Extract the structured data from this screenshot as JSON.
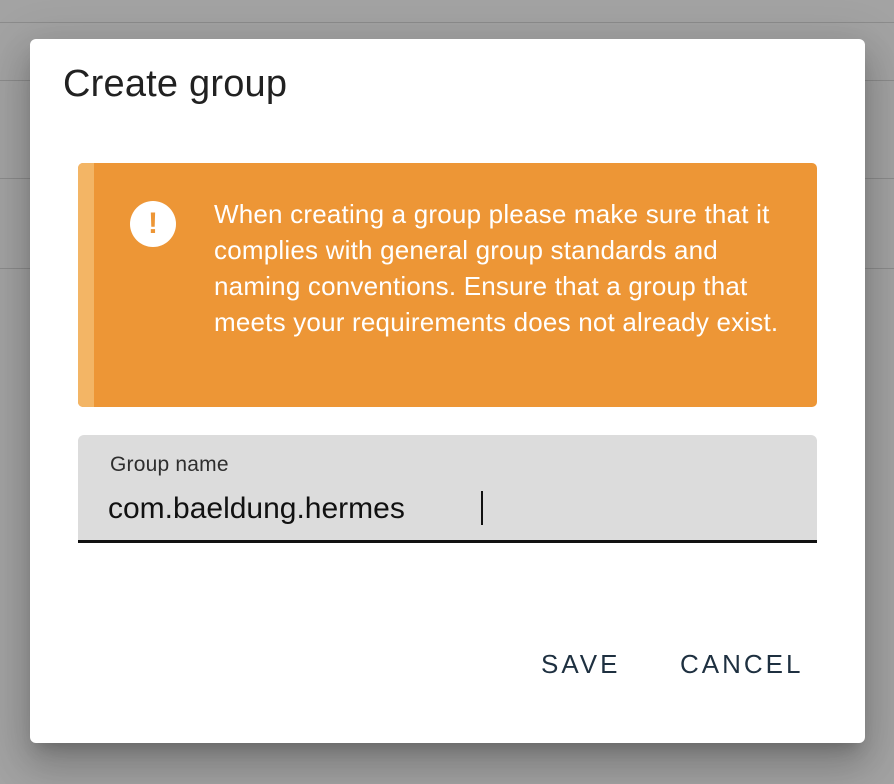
{
  "dialog": {
    "title": "Create group",
    "alert": {
      "icon": "exclamation-circle-icon",
      "icon_glyph": "!",
      "color": "#ed9636",
      "message": "When creating a group please make sure that it complies with general group standards and naming conventions. Ensure that a group that meets your requirements does not already exist."
    },
    "group_name_field": {
      "label": "Group name",
      "value": "com.baeldung.hermes"
    },
    "actions": {
      "save_label": "SAVE",
      "cancel_label": "CANCEL"
    }
  }
}
